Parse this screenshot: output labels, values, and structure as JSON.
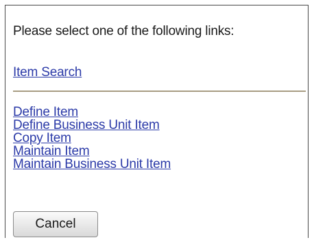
{
  "prompt": "Please select one of the following links:",
  "search_link": "Item Search",
  "links": [
    "Define Item",
    "Define Business Unit Item",
    "Copy Item",
    "Maintain Item",
    "Maintain Business Unit Item"
  ],
  "cancel_label": "Cancel",
  "colors": {
    "link": "#2b3aa8",
    "divider": "#a89c83",
    "border": "#4a4a4a"
  }
}
